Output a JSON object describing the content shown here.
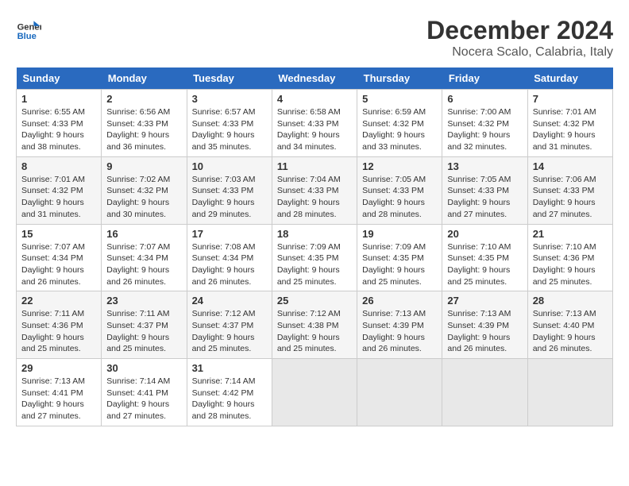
{
  "header": {
    "logo_line1": "General",
    "logo_line2": "Blue",
    "month_title": "December 2024",
    "subtitle": "Nocera Scalo, Calabria, Italy"
  },
  "weekdays": [
    "Sunday",
    "Monday",
    "Tuesday",
    "Wednesday",
    "Thursday",
    "Friday",
    "Saturday"
  ],
  "weeks": [
    [
      {
        "day": "1",
        "sunrise": "6:55 AM",
        "sunset": "4:33 PM",
        "daylight": "9 hours and 38 minutes."
      },
      {
        "day": "2",
        "sunrise": "6:56 AM",
        "sunset": "4:33 PM",
        "daylight": "9 hours and 36 minutes."
      },
      {
        "day": "3",
        "sunrise": "6:57 AM",
        "sunset": "4:33 PM",
        "daylight": "9 hours and 35 minutes."
      },
      {
        "day": "4",
        "sunrise": "6:58 AM",
        "sunset": "4:33 PM",
        "daylight": "9 hours and 34 minutes."
      },
      {
        "day": "5",
        "sunrise": "6:59 AM",
        "sunset": "4:32 PM",
        "daylight": "9 hours and 33 minutes."
      },
      {
        "day": "6",
        "sunrise": "7:00 AM",
        "sunset": "4:32 PM",
        "daylight": "9 hours and 32 minutes."
      },
      {
        "day": "7",
        "sunrise": "7:01 AM",
        "sunset": "4:32 PM",
        "daylight": "9 hours and 31 minutes."
      }
    ],
    [
      {
        "day": "8",
        "sunrise": "7:01 AM",
        "sunset": "4:32 PM",
        "daylight": "9 hours and 31 minutes."
      },
      {
        "day": "9",
        "sunrise": "7:02 AM",
        "sunset": "4:32 PM",
        "daylight": "9 hours and 30 minutes."
      },
      {
        "day": "10",
        "sunrise": "7:03 AM",
        "sunset": "4:33 PM",
        "daylight": "9 hours and 29 minutes."
      },
      {
        "day": "11",
        "sunrise": "7:04 AM",
        "sunset": "4:33 PM",
        "daylight": "9 hours and 28 minutes."
      },
      {
        "day": "12",
        "sunrise": "7:05 AM",
        "sunset": "4:33 PM",
        "daylight": "9 hours and 28 minutes."
      },
      {
        "day": "13",
        "sunrise": "7:05 AM",
        "sunset": "4:33 PM",
        "daylight": "9 hours and 27 minutes."
      },
      {
        "day": "14",
        "sunrise": "7:06 AM",
        "sunset": "4:33 PM",
        "daylight": "9 hours and 27 minutes."
      }
    ],
    [
      {
        "day": "15",
        "sunrise": "7:07 AM",
        "sunset": "4:34 PM",
        "daylight": "9 hours and 26 minutes."
      },
      {
        "day": "16",
        "sunrise": "7:07 AM",
        "sunset": "4:34 PM",
        "daylight": "9 hours and 26 minutes."
      },
      {
        "day": "17",
        "sunrise": "7:08 AM",
        "sunset": "4:34 PM",
        "daylight": "9 hours and 26 minutes."
      },
      {
        "day": "18",
        "sunrise": "7:09 AM",
        "sunset": "4:35 PM",
        "daylight": "9 hours and 25 minutes."
      },
      {
        "day": "19",
        "sunrise": "7:09 AM",
        "sunset": "4:35 PM",
        "daylight": "9 hours and 25 minutes."
      },
      {
        "day": "20",
        "sunrise": "7:10 AM",
        "sunset": "4:35 PM",
        "daylight": "9 hours and 25 minutes."
      },
      {
        "day": "21",
        "sunrise": "7:10 AM",
        "sunset": "4:36 PM",
        "daylight": "9 hours and 25 minutes."
      }
    ],
    [
      {
        "day": "22",
        "sunrise": "7:11 AM",
        "sunset": "4:36 PM",
        "daylight": "9 hours and 25 minutes."
      },
      {
        "day": "23",
        "sunrise": "7:11 AM",
        "sunset": "4:37 PM",
        "daylight": "9 hours and 25 minutes."
      },
      {
        "day": "24",
        "sunrise": "7:12 AM",
        "sunset": "4:37 PM",
        "daylight": "9 hours and 25 minutes."
      },
      {
        "day": "25",
        "sunrise": "7:12 AM",
        "sunset": "4:38 PM",
        "daylight": "9 hours and 25 minutes."
      },
      {
        "day": "26",
        "sunrise": "7:13 AM",
        "sunset": "4:39 PM",
        "daylight": "9 hours and 26 minutes."
      },
      {
        "day": "27",
        "sunrise": "7:13 AM",
        "sunset": "4:39 PM",
        "daylight": "9 hours and 26 minutes."
      },
      {
        "day": "28",
        "sunrise": "7:13 AM",
        "sunset": "4:40 PM",
        "daylight": "9 hours and 26 minutes."
      }
    ],
    [
      {
        "day": "29",
        "sunrise": "7:13 AM",
        "sunset": "4:41 PM",
        "daylight": "9 hours and 27 minutes."
      },
      {
        "day": "30",
        "sunrise": "7:14 AM",
        "sunset": "4:41 PM",
        "daylight": "9 hours and 27 minutes."
      },
      {
        "day": "31",
        "sunrise": "7:14 AM",
        "sunset": "4:42 PM",
        "daylight": "9 hours and 28 minutes."
      },
      null,
      null,
      null,
      null
    ]
  ]
}
